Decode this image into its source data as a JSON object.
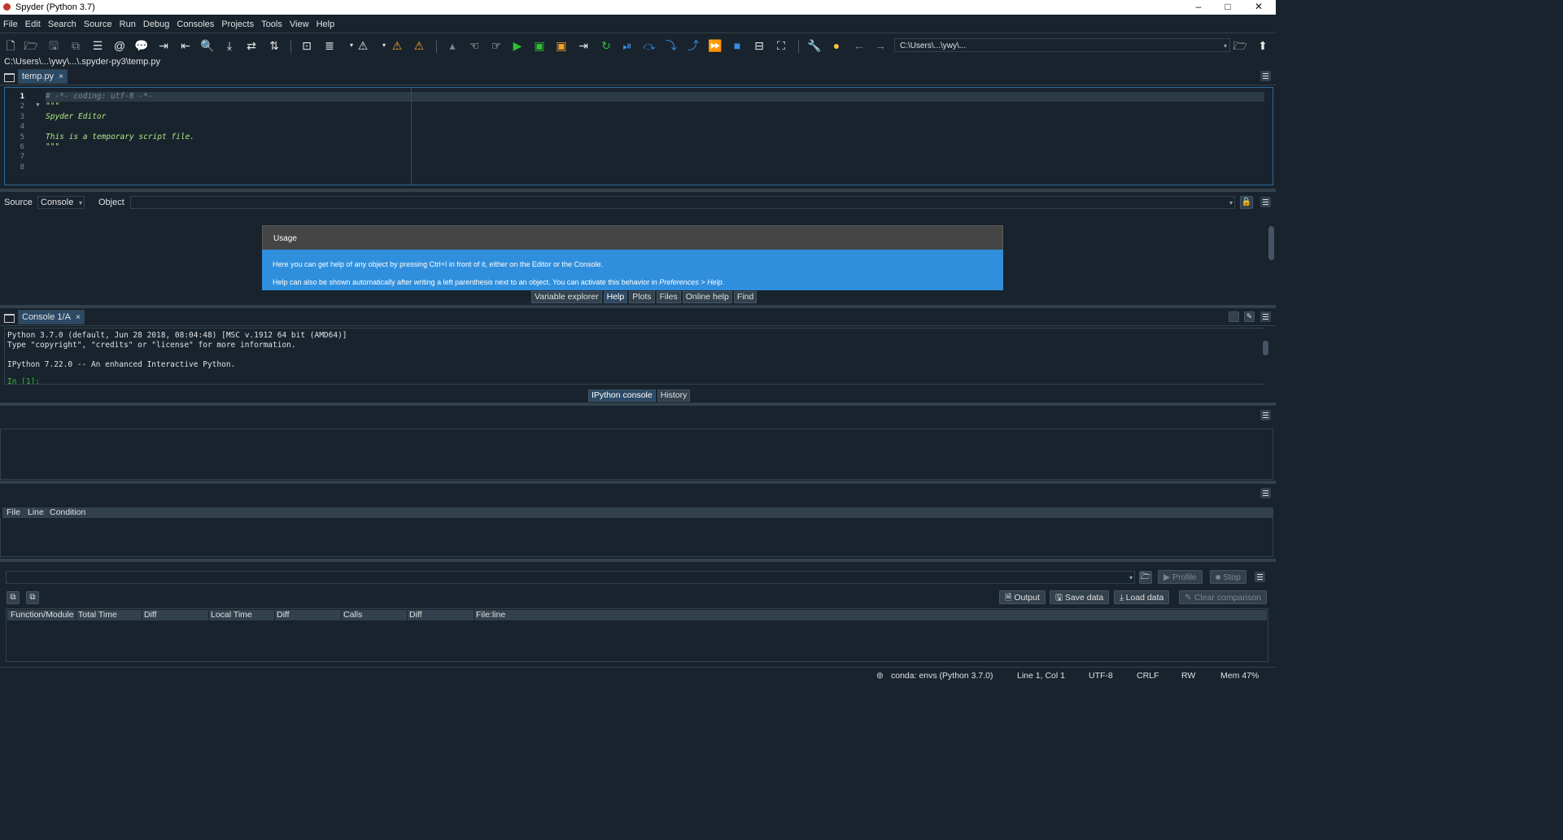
{
  "window": {
    "title": "Spyder (Python 3.7)",
    "min": "–",
    "max": "□",
    "close": "✕"
  },
  "menu": [
    "File",
    "Edit",
    "Search",
    "Source",
    "Run",
    "Debug",
    "Consoles",
    "Projects",
    "Tools",
    "View",
    "Help"
  ],
  "toolbar": {
    "path_value": "C:\\Users\\...\\ywy\\...",
    "path_dropdown": "▾"
  },
  "filepath": "C:\\Users\\...\\ywy\\...\\.spyder-py3\\temp.py",
  "editor": {
    "tab_label": "temp.py",
    "tab_close": "×",
    "line_numbers": [
      "1",
      "2",
      "3",
      "4",
      "5",
      "6",
      "7",
      "8"
    ],
    "lines": [
      "# -*- coding: utf-8 -*-",
      "\"\"\"",
      "Spyder Editor",
      "",
      "This is a temporary script file.",
      "\"\"\"",
      "",
      ""
    ]
  },
  "help": {
    "source_label": "Source",
    "source_value": "Console",
    "object_label": "Object",
    "object_value": "",
    "usage_title": "Usage",
    "usage_line1": "Here you can get help of any object by pressing Ctrl+I in front of it, either on the Editor or the Console.",
    "usage_line2_pre": "Help can also be shown automatically after writing a left parenthesis next to an object. You can activate this behavior in ",
    "usage_line2_link": "Preferences > Help",
    "usage_line2_post": ".",
    "tabs": [
      "Variable explorer",
      "Help",
      "Plots",
      "Files",
      "Online help",
      "Find"
    ]
  },
  "console": {
    "tab_label": "Console 1/A",
    "tab_close": "×",
    "lines": [
      "Python 3.7.0 (default, Jun 28 2018, 08:04:48) [MSC v.1912 64 bit (AMD64)]",
      "Type \"copyright\", \"credits\" or \"license\" for more information.",
      "",
      "IPython 7.22.0 -- An enhanced Interactive Python."
    ],
    "prompt": "In [1]:",
    "tabs": [
      "IPython console",
      "History"
    ]
  },
  "breakpoints": {
    "columns": [
      "File",
      "Line",
      "Condition"
    ]
  },
  "profiler": {
    "combo_value": "",
    "profile_label": "Profile",
    "stop_label": "Stop",
    "output_label": "Output",
    "save_label": "Save data",
    "load_label": "Load data",
    "clear_label": "Clear comparison",
    "columns": [
      "Function/Module",
      "Total Time",
      "Diff",
      "Local Time",
      "Diff",
      "Calls",
      "Diff",
      "File:line"
    ]
  },
  "status": {
    "env": "conda: envs (Python 3.7.0)",
    "position": "Line 1, Col 1",
    "encoding": "UTF-8",
    "eol": "CRLF",
    "rw": "RW",
    "mem": "Mem 47%"
  },
  "colors": {
    "background": "#19232d",
    "border": "#32414b",
    "accent": "#2f8fdd",
    "usage_header": "#454545",
    "string": "#b0e686",
    "prompt": "#2fbf32"
  }
}
